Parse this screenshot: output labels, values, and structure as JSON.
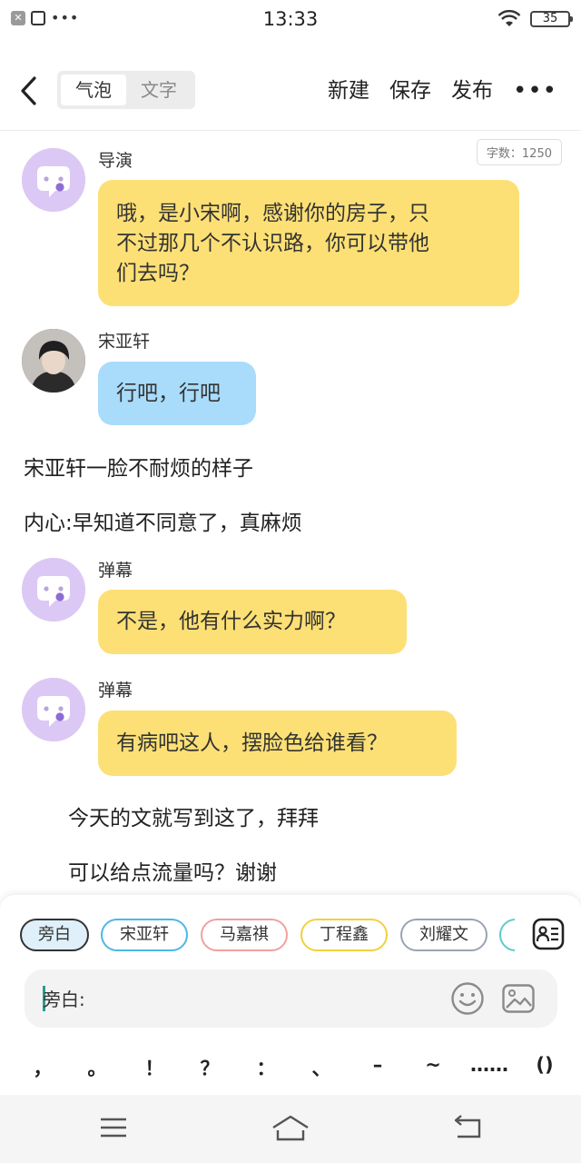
{
  "status_bar": {
    "time": "13:33",
    "battery": "35"
  },
  "header": {
    "seg_bubble": "气泡",
    "seg_text": "文字",
    "btn_new": "新建",
    "btn_save": "保存",
    "btn_publish": "发布",
    "more": "•••"
  },
  "word_count": "字数：1250",
  "messages": [
    {
      "sender": "导演",
      "text": [
        "哦，是小宋啊，感谢你的房子，只",
        "不过那几个不认识路，你可以带他",
        "们去吗？"
      ],
      "color": "#fde075"
    },
    {
      "sender": "宋亚轩",
      "text": [
        "行吧，行吧"
      ],
      "color": "#a9dcfb"
    },
    {
      "sender": "弹幕",
      "text": [
        "不是，他有什么实力啊？"
      ],
      "color": "#fde075"
    },
    {
      "sender": "弹幕",
      "text": [
        "有病吧这人，摆脸色给谁看？"
      ],
      "color": "#fde075"
    }
  ],
  "narration": [
    "宋亚轩一脸不耐烦的样子",
    "内心:早知道不同意了，真麻烦",
    "今天的文就写到这了，拜拜",
    "可以给点流量吗？谢谢"
  ],
  "chips": [
    {
      "label": "旁白",
      "color": "#333333"
    },
    {
      "label": "宋亚轩",
      "color": "#4cb6e8"
    },
    {
      "label": "马嘉祺",
      "color": "#f0a0a0"
    },
    {
      "label": "丁程鑫",
      "color": "#f3cf3f"
    },
    {
      "label": "刘耀文",
      "color": "#9aa4b2"
    }
  ],
  "input": {
    "label": "旁白:"
  },
  "punctuation": [
    "，",
    "。",
    "！",
    "？",
    "：",
    "、",
    "–",
    "~",
    "……",
    "()"
  ]
}
